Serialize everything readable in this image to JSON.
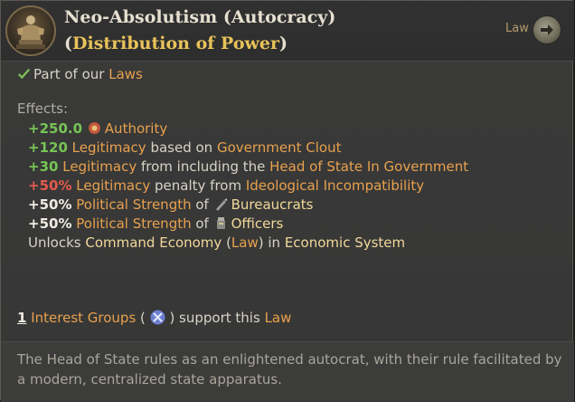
{
  "header": {
    "title_main": "Neo-Absolutism (Autocracy) (",
    "title_group": "Distribution of Power",
    "title_close": ")",
    "type_label": "Law",
    "law_icon": "figure-statue-icon",
    "go_icon": "arrow-right-icon"
  },
  "status": {
    "check_icon": "checkmark-icon",
    "prefix": "Part of our ",
    "link": "Laws"
  },
  "effects": {
    "heading": "Effects:",
    "authority": {
      "value": "+250.0",
      "icon": "authority-icon",
      "label": "Authority"
    },
    "clout": {
      "value": "+120",
      "label": "Legitimacy",
      "mid": " based on ",
      "source": "Government Clout"
    },
    "head_of_state": {
      "value": "+30",
      "label": "Legitimacy",
      "mid": " from including the ",
      "source": "Head of State In Government"
    },
    "incompat": {
      "value": "+50%",
      "label": "Legitimacy",
      "mid": " penalty from ",
      "source": "Ideological Incompatibility"
    },
    "bureaucrats": {
      "value": "+50%",
      "label": "Political Strength",
      "mid": " of ",
      "icon": "bureaucrats-icon",
      "group": "Bureaucrats"
    },
    "officers": {
      "value": "+50%",
      "label": "Political Strength",
      "mid": " of ",
      "icon": "officers-icon",
      "group": "Officers"
    },
    "unlocks": {
      "prefix": "Unlocks ",
      "item": "Command Economy",
      "open": " (",
      "type": "Law",
      "close": ")",
      "mid": " in ",
      "category": "Economic System"
    }
  },
  "support": {
    "count": "1",
    "label": "Interest Groups",
    "open": " ( ",
    "icon": "crossed-swords-icon",
    "close": " ) support this ",
    "link": "Law"
  },
  "description": "The Head of State rules as an enlightened autocrat, with their rule facilitated by a modern, centralized state apparatus.",
  "colors": {
    "positive": "#77c455",
    "negative": "#e55a4e",
    "link": "#e7a14e",
    "title_highlight": "#e8c25a"
  }
}
